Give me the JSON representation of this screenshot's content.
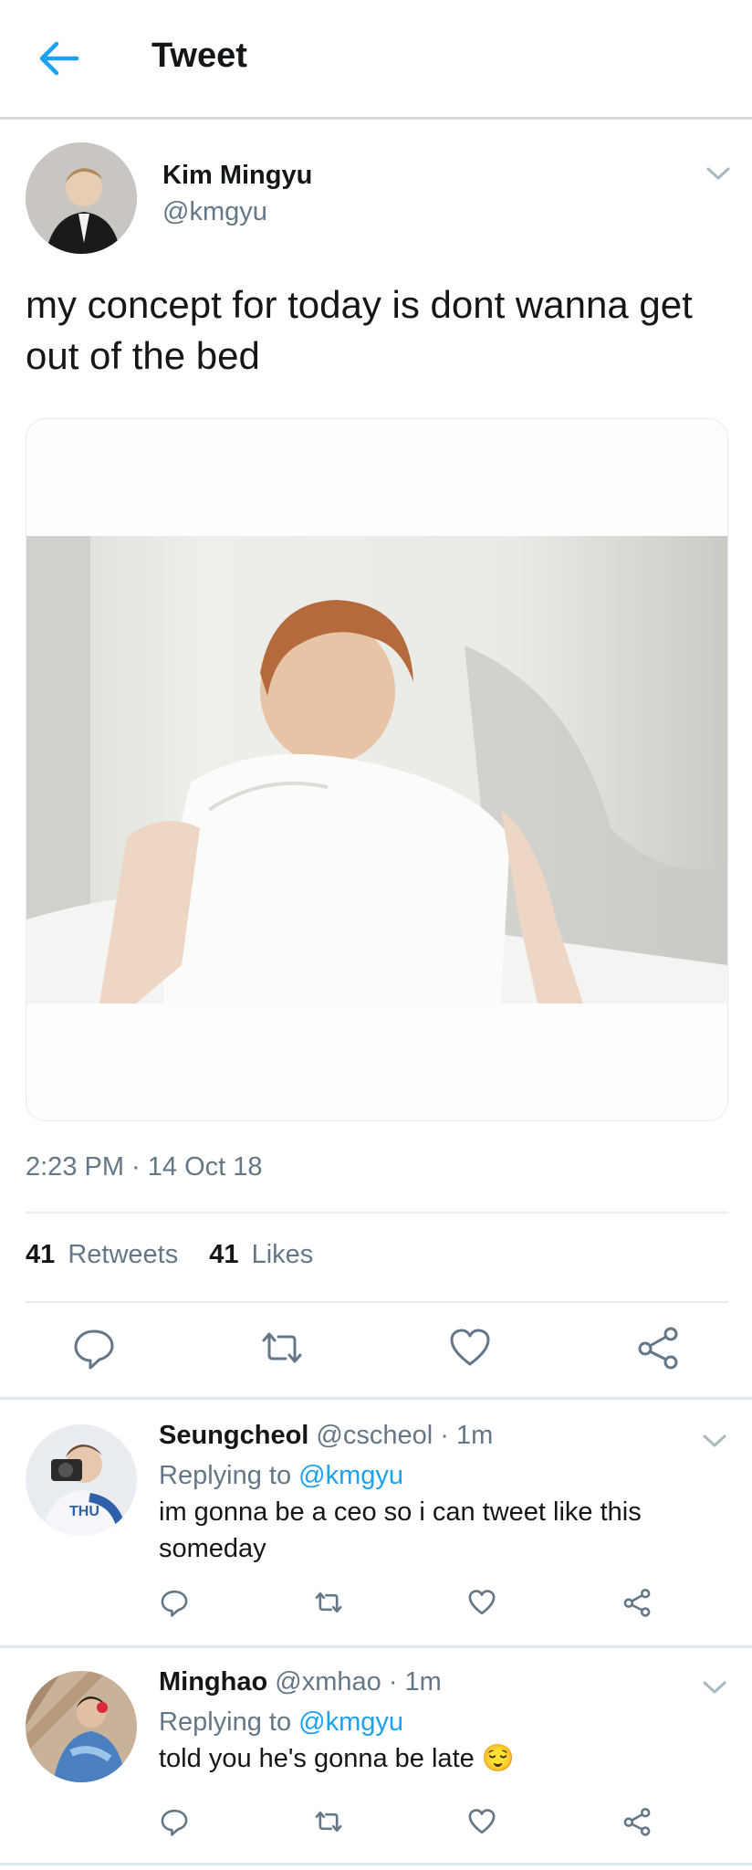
{
  "header": {
    "title": "Tweet",
    "back_icon": "arrow-left-icon"
  },
  "tweet": {
    "author_name": "Kim Mingyu",
    "author_handle": "@kmgyu",
    "text": "my concept for today is dont wanna get out of the bed",
    "time": "2:23 PM · 14 Oct 18",
    "retweets_count": "41",
    "retweets_label": "Retweets",
    "likes_count": "41",
    "likes_label": "Likes",
    "actions": [
      "reply-icon",
      "retweet-icon",
      "like-icon",
      "share-icon"
    ]
  },
  "replies": [
    {
      "name": "Seungcheol",
      "handle": "@cscheol",
      "time": "· 1m",
      "replying_prefix": "Replying to",
      "replying_to": "@kmgyu",
      "text": "im gonna be a ceo so i can tweet like this someday"
    },
    {
      "name": "Minghao",
      "handle": "@xmhao",
      "time": "· 1m",
      "replying_prefix": "Replying to",
      "replying_to": "@kmgyu",
      "text": "told you he's gonna be late",
      "emoji": "😌"
    }
  ],
  "colors": {
    "accent": "#1da1f2",
    "text": "#14171a",
    "muted": "#657786",
    "divider": "#e6ecf0"
  }
}
